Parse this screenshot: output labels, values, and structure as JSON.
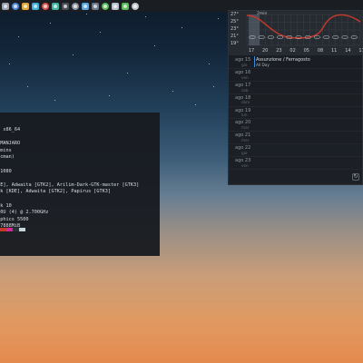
{
  "panel": {
    "icons": [
      {
        "name": "apps-icon",
        "color": "#9aa3ad"
      },
      {
        "name": "browser-icon",
        "color": "#4f8ad6"
      },
      {
        "name": "files-icon",
        "color": "#e0a53a"
      },
      {
        "name": "chat-icon",
        "color": "#3fb0d9"
      },
      {
        "name": "music-icon",
        "color": "#d9534f"
      },
      {
        "name": "image-icon",
        "color": "#3fb7a1"
      },
      {
        "name": "terminal-icon",
        "color": "#4a4f57"
      },
      {
        "name": "settings-icon",
        "color": "#8b95a1"
      },
      {
        "name": "mail-icon",
        "color": "#5aa7e0"
      },
      {
        "name": "camera-icon",
        "color": "#6c7a89"
      },
      {
        "name": "download-icon",
        "color": "#5cb85c"
      },
      {
        "name": "battery-icon",
        "color": "#b8c1cb"
      },
      {
        "name": "network-icon",
        "color": "#5cb85c"
      },
      {
        "name": "volume-icon",
        "color": "#c0c7cf"
      }
    ]
  },
  "terminal": {
    "lines": [
      "ux x86_64",
      "3",
      "1-MANJARO",
      "4 mins",
      " pacman)",
      "7",
      "0x1080",
      "",
      "KDE], Adwaita [GTK2], Arilim-Dark-GTK-master [GTK3]",
      "ark [KDE], Adwaita [GTK2], Papirus [GTK3]",
      "e",
      "ack 10",
      "200U (4) @ 2.700GHz",
      "raphics 5500",
      "/ 7888MiB"
    ],
    "palette": [
      "#c0392b",
      "#d6249f",
      "#2b2f36",
      "#c3d6dc"
    ]
  },
  "calendar": {
    "forecast": {
      "now_label": "2min",
      "y_ticks": [
        "27°",
        "25°",
        "23°",
        "21°",
        "19°"
      ],
      "x_ticks": [
        "17",
        "20",
        "23",
        "02",
        "05",
        "08",
        "11",
        "14",
        "17"
      ],
      "grid_color": "#3a4048",
      "line_color": "#c0392b"
    },
    "agenda": [
      {
        "date": "ago 15",
        "weekday": "gio",
        "event_title": "Assunzione / Ferragosto",
        "event_sub": "All Day"
      },
      {
        "date": "ago 16",
        "weekday": "ven"
      },
      {
        "date": "ago 17",
        "weekday": "sab"
      },
      {
        "date": "ago 18",
        "weekday": "dom"
      },
      {
        "date": "ago 19",
        "weekday": "lun"
      },
      {
        "date": "ago 20",
        "weekday": "mar"
      },
      {
        "date": "ago 21",
        "weekday": "mer"
      },
      {
        "date": "ago 22",
        "weekday": "gio"
      },
      {
        "date": "ago 23",
        "weekday": "ven"
      }
    ]
  }
}
